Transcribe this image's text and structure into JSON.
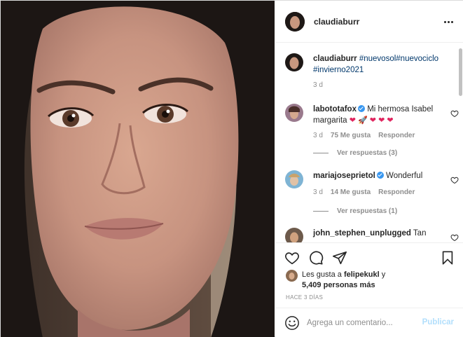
{
  "post": {
    "author": "claudiaburr",
    "more_icon": "more-horizontal-icon"
  },
  "caption": {
    "user": "claudiaburr",
    "tags": [
      "#nuevosol",
      "#nuevociclo",
      "#invierno2021"
    ],
    "time": "3 d"
  },
  "comments": [
    {
      "user": "labototafox",
      "verified": true,
      "text": "Mi hermosa Isabel margarita",
      "emojis": "❤ 🚀 ❤ ❤ ❤",
      "time": "3 d",
      "likes": "75 Me gusta",
      "reply": "Responder",
      "replies": "Ver respuestas (3)"
    },
    {
      "user": "mariajoseprietol",
      "verified": true,
      "text": "Wonderful",
      "time": "3 d",
      "likes": "14 Me gusta",
      "reply": "Responder",
      "replies": "Ver respuestas (1)"
    },
    {
      "user": "john_stephen_unplugged",
      "text": "Tan"
    }
  ],
  "actions": {
    "like_icon": "heart-icon",
    "comment_icon": "comment-icon",
    "share_icon": "share-icon",
    "save_icon": "bookmark-icon"
  },
  "likes": {
    "prefix": "Les gusta a",
    "user": "felipekukl",
    "suffix": "y",
    "count": "5,409",
    "count_suffix": "personas más"
  },
  "timestamp": "HACE 3 DÍAS",
  "add_comment": {
    "placeholder": "Agrega un comentario...",
    "post_label": "Publicar",
    "emoji_icon": "emoji-icon"
  },
  "colors": {
    "link": "#00376b",
    "verified": "#3897f0",
    "publish_disabled": "#b2dffc"
  }
}
